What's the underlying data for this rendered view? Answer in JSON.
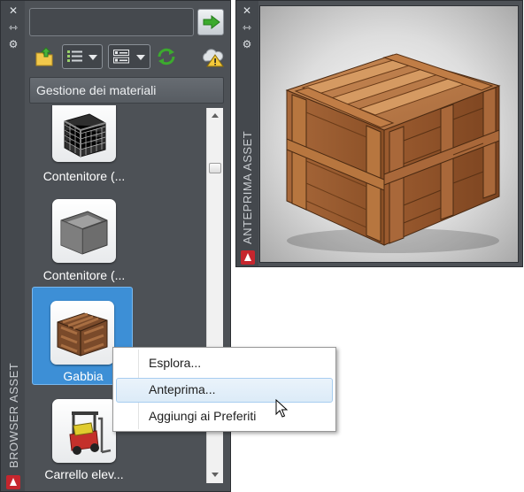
{
  "browser_palette": {
    "title": "BROWSER ASSET",
    "search": {
      "value": "",
      "placeholder": ""
    },
    "category_header": "Gestione dei materiali",
    "assets": [
      {
        "label": "Contenitore (...",
        "icon": "wire-cage-box-icon",
        "selected": false
      },
      {
        "label": "Contenitore (...",
        "icon": "open-box-icon",
        "selected": false
      },
      {
        "label": "Gabbia",
        "icon": "wooden-crate-icon",
        "selected": true
      },
      {
        "label": "Carrello elev...",
        "icon": "forklift-icon",
        "selected": false
      }
    ]
  },
  "preview_palette": {
    "title": "ANTEPRIMA ASSET",
    "image": "wooden-crate-3d-render"
  },
  "context_menu": {
    "items": [
      {
        "label": "Esplora...",
        "highlighted": false
      },
      {
        "label": "Anteprima...",
        "highlighted": true
      },
      {
        "label": "Aggiungi ai Preferiti",
        "highlighted": false
      }
    ]
  },
  "colors": {
    "panel_bg": "#4d5156",
    "selection": "#3d8fd6",
    "menu_highlight": "#dcebf8",
    "accent_green": "#3caa2e"
  }
}
